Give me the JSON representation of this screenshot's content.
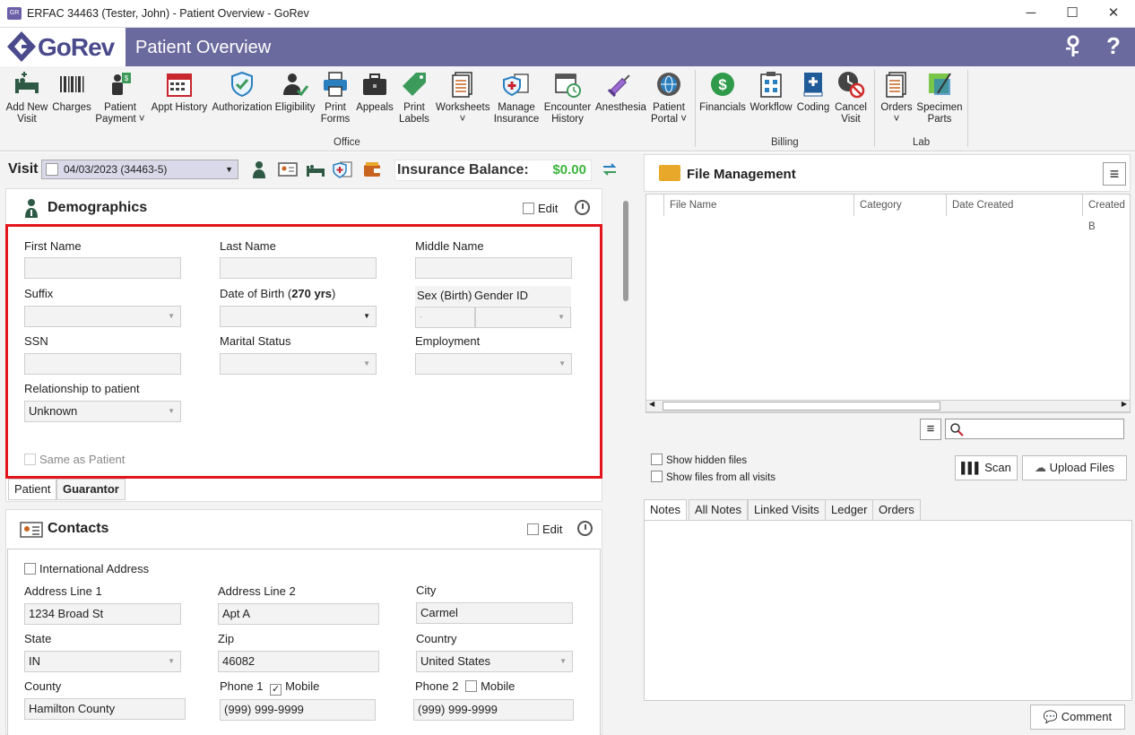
{
  "window": {
    "app_icon": "gorev-app-icon",
    "title": "ERFAC 34463 (Tester, John) - Patient Overview - GoRev",
    "minimize": "─",
    "maximize": "☐",
    "close": "✕"
  },
  "banner": {
    "logo": "GoRev",
    "page_title": "Patient Overview",
    "key_icon": "key-icon",
    "help": "?"
  },
  "ribbon": {
    "office": {
      "group_label": "Office",
      "buttons": [
        {
          "label": "Add New\nVisit",
          "icon": "bed-plus-icon"
        },
        {
          "label": "Charges",
          "icon": "barcode-icon"
        },
        {
          "label": "Patient\nPayment ˅",
          "icon": "payment-icon"
        },
        {
          "label": "Appt History",
          "icon": "calendar-icon"
        },
        {
          "label": "Authorization",
          "icon": "shield-check-icon"
        },
        {
          "label": "Eligibility",
          "icon": "person-check-icon"
        },
        {
          "label": "Print\nForms",
          "icon": "printer-icon"
        },
        {
          "label": "Appeals",
          "icon": "briefcase-icon"
        },
        {
          "label": "Print\nLabels",
          "icon": "tag-icon"
        },
        {
          "label": "Worksheets\n˅",
          "icon": "worksheet-icon"
        },
        {
          "label": "Manage\nInsurance",
          "icon": "insurance-icon"
        },
        {
          "label": "Encounter\nHistory",
          "icon": "encounter-history-icon"
        },
        {
          "label": "Anesthesia",
          "icon": "syringe-icon"
        },
        {
          "label": "Patient\nPortal ˅",
          "icon": "gear-globe-icon"
        }
      ]
    },
    "billing": {
      "group_label": "Billing",
      "buttons": [
        {
          "label": "Financials",
          "icon": "dollar-icon"
        },
        {
          "label": "Workflow",
          "icon": "workflow-icon"
        },
        {
          "label": "Coding",
          "icon": "book-plus-icon"
        },
        {
          "label": "Cancel\nVisit",
          "icon": "cancel-clock-icon"
        }
      ]
    },
    "lab": {
      "group_label": "Lab",
      "buttons": [
        {
          "label": "Orders\n˅",
          "icon": "orders-icon"
        },
        {
          "label": "Specimen\nParts",
          "icon": "specimen-icon"
        }
      ]
    }
  },
  "visit": {
    "label": "Visit",
    "selected": "04/03/2023 (34463-5)",
    "insurance_balance_label": "Insurance Balance:",
    "insurance_balance_value": "$0.00"
  },
  "demographics": {
    "title": "Demographics",
    "edit_label": "Edit",
    "first_name_label": "First Name",
    "last_name_label": "Last Name",
    "middle_name_label": "Middle Name",
    "suffix_label": "Suffix",
    "dob_label_prefix": "Date of Birth (",
    "dob_age": "270 yrs",
    "dob_label_suffix": ")",
    "sex_label": "Sex (Birth)",
    "gender_label": "Gender ID",
    "ssn_label": "SSN",
    "marital_label": "Marital Status",
    "employment_label": "Employment",
    "relationship_label": "Relationship to patient",
    "relationship_value": "Unknown",
    "same_as_patient": "Same as Patient",
    "tabs": [
      "Patient",
      "Guarantor"
    ]
  },
  "contacts": {
    "title": "Contacts",
    "edit_label": "Edit",
    "international_label": "International Address",
    "address1_label": "Address Line 1",
    "address1_value": "1234 Broad St",
    "address2_label": "Address Line 2",
    "address2_value": "Apt A",
    "city_label": "City",
    "city_value": "Carmel",
    "state_label": "State",
    "state_value": "IN",
    "zip_label": "Zip",
    "zip_value": "46082",
    "country_label": "Country",
    "country_value": "United States",
    "county_label": "County",
    "county_value": "Hamilton County",
    "phone1_label": "Phone 1",
    "phone1_mobile": "Mobile",
    "phone1_value": "(999) 999-9999",
    "phone2_label": "Phone 2",
    "phone2_mobile": "Mobile",
    "phone2_value": "(999) 999-9999"
  },
  "file_management": {
    "title": "File Management",
    "columns": [
      "File Name",
      "Category",
      "Date Created",
      "Created B"
    ],
    "show_hidden": "Show hidden files",
    "show_all_visits": "Show files from all visits",
    "scan_button": "Scan",
    "upload_button": "Upload Files"
  },
  "notes": {
    "tabs": [
      "Notes",
      "All Notes",
      "Linked Visits",
      "Ledger",
      "Orders"
    ],
    "comment_button": "Comment"
  }
}
